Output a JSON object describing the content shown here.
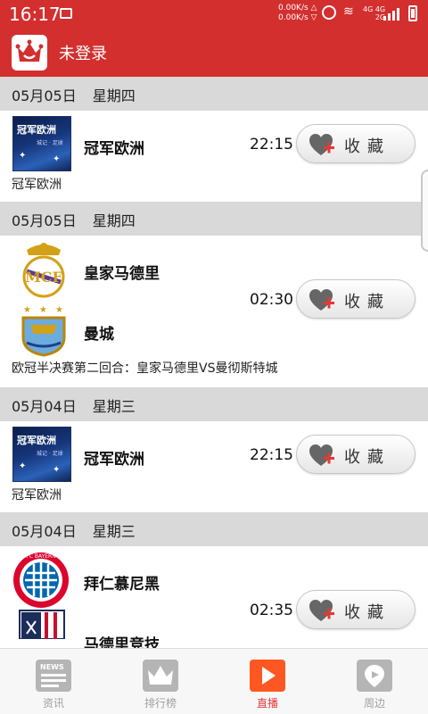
{
  "status_bar": {
    "time": "16:17",
    "net_up": "0.00K/s △",
    "net_down": "0.00K/s ▽",
    "signal_top": "4G  4G",
    "signal_bottom": "2G",
    "icons": [
      "gallery-icon",
      "alarm-icon",
      "wifi-icon",
      "cell-signal-icon",
      "battery-charging-icon"
    ]
  },
  "app_bar": {
    "login_text": "未登录",
    "logo_icon": "crown-logo-icon",
    "color": "#d32f2f"
  },
  "favorite_label": "收藏",
  "sections": [
    {
      "date": "05月05日",
      "weekday": "星期四",
      "match": {
        "type": "single",
        "team": "冠军欧洲",
        "time": "22:15",
        "caption": "冠军欧洲",
        "logo_text": "冠军欧洲",
        "logo_sub": "城记 · 足球"
      }
    },
    {
      "date": "05月05日",
      "weekday": "星期四",
      "match": {
        "type": "double",
        "home": "皇家马德里",
        "away": "曼城",
        "time": "02:30",
        "caption": "欧冠半决赛第二回合：皇家马德里VS曼彻斯特城"
      }
    },
    {
      "date": "05月04日",
      "weekday": "星期三",
      "match": {
        "type": "single",
        "team": "冠军欧洲",
        "time": "22:15",
        "caption": "冠军欧洲",
        "logo_text": "冠军欧洲",
        "logo_sub": "城记 · 足球"
      }
    },
    {
      "date": "05月04日",
      "weekday": "星期三",
      "match": {
        "type": "double",
        "home": "拜仁慕尼黑",
        "away": "马德里竞技",
        "time": "02:35",
        "caption": ""
      }
    }
  ],
  "bottom_nav": [
    {
      "label": "资讯",
      "icon": "news-icon",
      "active": false
    },
    {
      "label": "排行榜",
      "icon": "crown-icon",
      "active": false
    },
    {
      "label": "直播",
      "icon": "play-icon",
      "active": true
    },
    {
      "label": "周边",
      "icon": "location-icon",
      "active": false
    }
  ],
  "colors": {
    "accent": "#d32f2f",
    "active_nav": "#e53935",
    "section_bg": "#d9d9d9"
  }
}
